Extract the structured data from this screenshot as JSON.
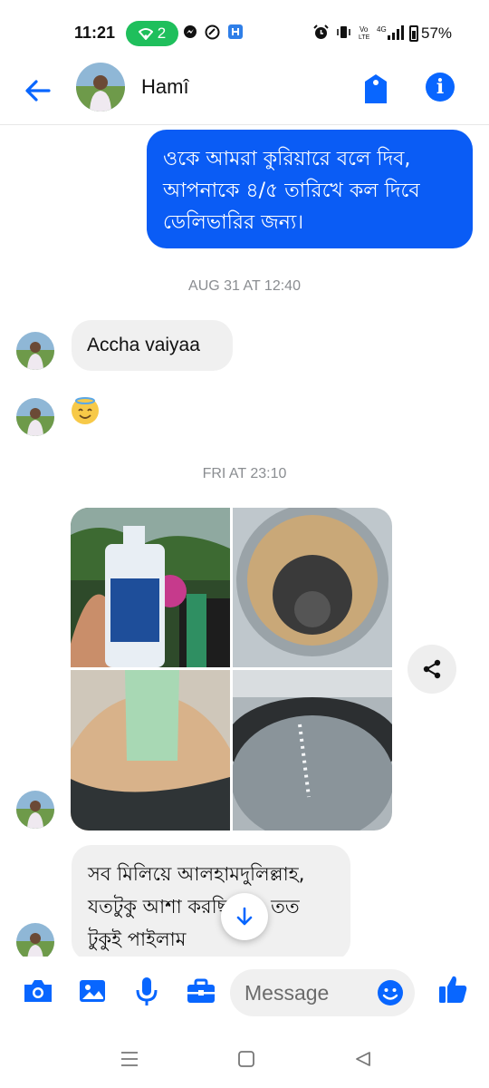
{
  "status_bar": {
    "time": "11:21",
    "wifi_count": "2",
    "battery": "57%"
  },
  "header": {
    "contact_name": "Hamî"
  },
  "messages": {
    "outgoing_1": "ওকে আমরা কুরিয়ারে বলে দিব, আপনাকে ৪/৫ তারিখে কল দিবে ডেলিভারির জন্য।",
    "timestamp_1": "AUG 31 AT 12:40",
    "incoming_1": "Accha vaiyaa",
    "incoming_2_emoji": "😇",
    "timestamp_2": "FRI AT 23:10",
    "incoming_last": "সব মিলিয়ে আলহামদুলিল্লাহ, যতটুকু আশা করছিলাম, তত টুকুই পাইলাম"
  },
  "composer": {
    "placeholder": "Message"
  },
  "colors": {
    "accent": "#0866ff",
    "bubble_out": "#0a5cf5",
    "bubble_in": "#f0f0f0"
  }
}
